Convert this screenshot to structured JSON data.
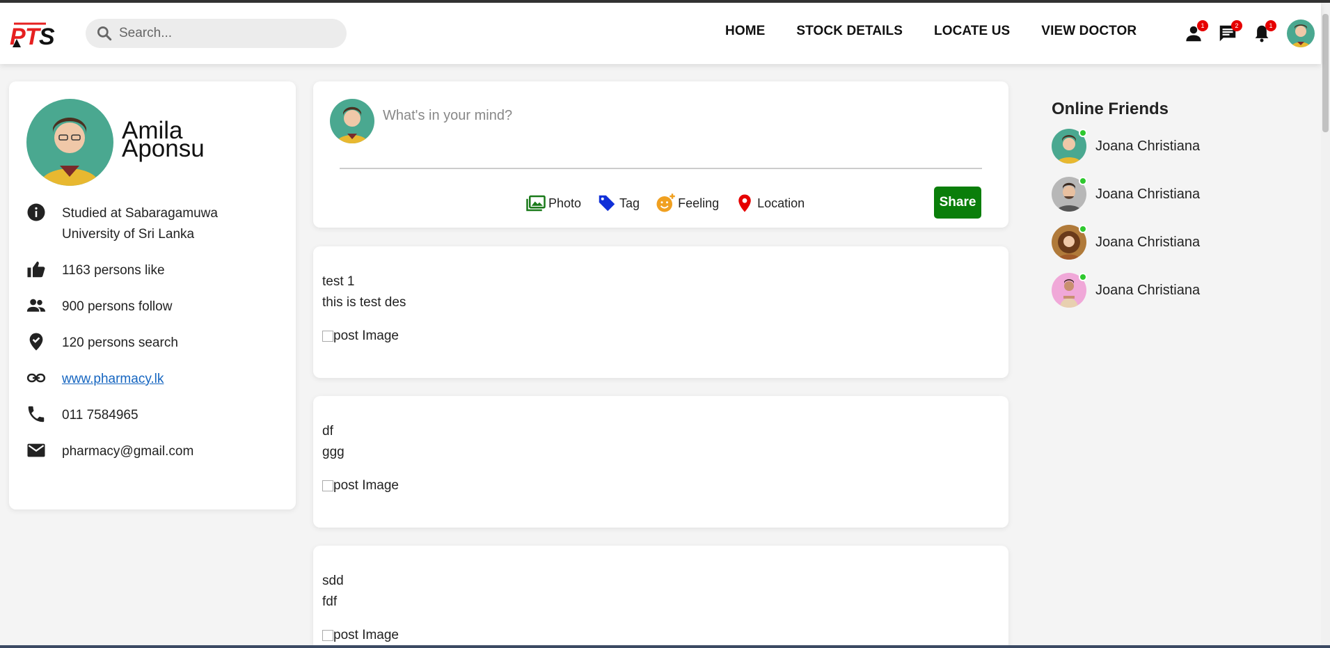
{
  "brand": {
    "logo_text": "PTS"
  },
  "search": {
    "placeholder": "Search..."
  },
  "nav": {
    "links": [
      "HOME",
      "STOCK DETAILS",
      "LOCATE US",
      "VIEW DOCTOR"
    ],
    "icons": [
      {
        "icon": "person-icon",
        "badge": "1"
      },
      {
        "icon": "chat-icon",
        "badge": "2"
      },
      {
        "icon": "bell-icon",
        "badge": "1"
      }
    ]
  },
  "profile": {
    "first_name": "Amila",
    "last_name": "Aponsu",
    "studied": "Studied at Sabaragamuwa University of Sri Lanka",
    "likes": "1163 persons like",
    "follows": "900 persons follow",
    "searches": "120 persons search",
    "website": "www.pharmacy.lk",
    "phone": "011 7584965",
    "email": "pharmacy@gmail.com"
  },
  "composer": {
    "placeholder": "What's in your mind?",
    "actions": [
      "Photo",
      "Tag",
      "Feeling",
      "Location"
    ],
    "share_label": "Share"
  },
  "posts": [
    {
      "title": "test 1",
      "desc": "this is test des",
      "image_alt": "post Image"
    },
    {
      "title": "df",
      "desc": "ggg",
      "image_alt": "post Image"
    },
    {
      "title": "sdd",
      "desc": "fdf",
      "image_alt": "post Image"
    }
  ],
  "friends": {
    "heading": "Online Friends",
    "items": [
      {
        "name": "Joana Christiana",
        "avatar_bg": "#4aa890"
      },
      {
        "name": "Joana Christiana",
        "avatar_bg": "#b7b7b7"
      },
      {
        "name": "Joana Christiana",
        "avatar_bg": "#b07a3a"
      },
      {
        "name": "Joana Christiana",
        "avatar_bg": "#f0a8d8"
      }
    ]
  },
  "colors": {
    "share_green": "#0a7e0a",
    "badge_red": "#e60000",
    "online_green": "#2ec82e",
    "link_blue": "#1565c0"
  }
}
